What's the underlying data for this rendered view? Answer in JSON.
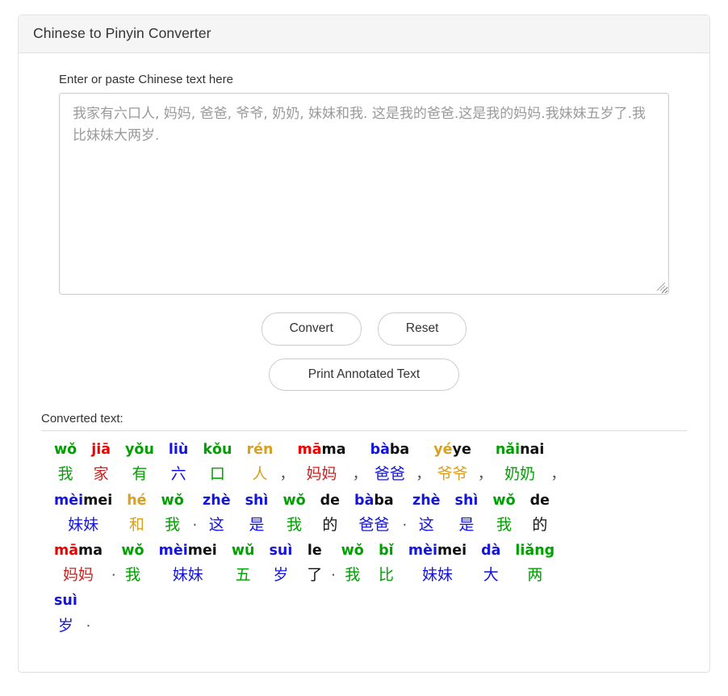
{
  "card": {
    "title": "Chinese to Pinyin Converter"
  },
  "input": {
    "label": "Enter or paste Chinese text here",
    "value": "我家有六口人, 妈妈, 爸爸, 爷爷, 奶奶, 妹妹和我. 这是我的爸爸.这是我的妈妈.我妹妹五岁了.我比妹妹大两岁.",
    "placeholder": ""
  },
  "buttons": {
    "convert": "Convert",
    "reset": "Reset",
    "print": "Print Annotated Text"
  },
  "output": {
    "label": "Converted text:",
    "tone_colors": {
      "tone1": "#ee0000",
      "tone2": "#d9a022",
      "tone3": "#00a000",
      "tone4": "#1414e0",
      "neutral": "#111111"
    },
    "lines": [
      [
        {
          "pinyin": "wǒ",
          "hanzi": "我",
          "tone": "t3",
          "hanzi_tone": "t3d"
        },
        {
          "pinyin": "jiā",
          "hanzi": "家",
          "tone": "t1",
          "hanzi_tone": "t1d"
        },
        {
          "pinyin": "yǒu",
          "hanzi": "有",
          "tone": "t3",
          "hanzi_tone": "t3d"
        },
        {
          "pinyin": "liù",
          "hanzi": "六",
          "tone": "t4",
          "hanzi_tone": "t4d"
        },
        {
          "pinyin": "kǒu",
          "hanzi": "口",
          "tone": "t3",
          "hanzi_tone": "t3d"
        },
        {
          "pinyin": "rén",
          "hanzi": "人",
          "tone": "t2",
          "hanzi_tone": "t2d"
        },
        {
          "pinyin": "",
          "hanzi": "，",
          "tone": "t5",
          "hanzi_tone": "punctmark",
          "punct": true
        },
        {
          "pinyin": "māma",
          "hanzi": "妈妈",
          "tone": "t1",
          "hanzi_tone": "t1d",
          "tone2part": "t5",
          "split": 2
        },
        {
          "pinyin": "",
          "hanzi": "，",
          "tone": "t5",
          "hanzi_tone": "punctmark",
          "punct": true
        },
        {
          "pinyin": "bàba",
          "hanzi": "爸爸",
          "tone": "t4",
          "hanzi_tone": "t4d",
          "tone2part": "t5",
          "split": 2
        },
        {
          "pinyin": "",
          "hanzi": "，",
          "tone": "t5",
          "hanzi_tone": "punctmark",
          "punct": true
        },
        {
          "pinyin": "yéye",
          "hanzi": "爷爷",
          "tone": "t2",
          "hanzi_tone": "t2d",
          "tone2part": "t5",
          "split": 2
        },
        {
          "pinyin": "",
          "hanzi": "，",
          "tone": "t5",
          "hanzi_tone": "punctmark",
          "punct": true
        },
        {
          "pinyin": "nǎinai",
          "hanzi": "奶奶",
          "tone": "t3",
          "hanzi_tone": "t3d",
          "tone2part": "t5",
          "split": 3
        },
        {
          "pinyin": "",
          "hanzi": "，",
          "tone": "t5",
          "hanzi_tone": "punctmark",
          "punct": true
        }
      ],
      [
        {
          "pinyin": "mèimei",
          "hanzi": "妹妹",
          "tone": "t4",
          "hanzi_tone": "t4d",
          "tone2part": "t5",
          "split": 3
        },
        {
          "pinyin": "hé",
          "hanzi": "和",
          "tone": "t2",
          "hanzi_tone": "t2d"
        },
        {
          "pinyin": "wǒ",
          "hanzi": "我",
          "tone": "t3",
          "hanzi_tone": "t3d"
        },
        {
          "pinyin": "",
          "hanzi": "·",
          "tone": "t5",
          "hanzi_tone": "punctmark",
          "punct": true
        },
        {
          "pinyin": "zhè",
          "hanzi": "这",
          "tone": "t4",
          "hanzi_tone": "t4d"
        },
        {
          "pinyin": "shì",
          "hanzi": "是",
          "tone": "t4",
          "hanzi_tone": "t4d"
        },
        {
          "pinyin": "wǒ",
          "hanzi": "我",
          "tone": "t3",
          "hanzi_tone": "t3d"
        },
        {
          "pinyin": "de",
          "hanzi": "的",
          "tone": "t5",
          "hanzi_tone": "t5"
        },
        {
          "pinyin": "bàba",
          "hanzi": "爸爸",
          "tone": "t4",
          "hanzi_tone": "t4d",
          "tone2part": "t5",
          "split": 2
        },
        {
          "pinyin": "",
          "hanzi": "·",
          "tone": "t5",
          "hanzi_tone": "punctmark",
          "punct": true
        },
        {
          "pinyin": "zhè",
          "hanzi": "这",
          "tone": "t4",
          "hanzi_tone": "t4d"
        },
        {
          "pinyin": "shì",
          "hanzi": "是",
          "tone": "t4",
          "hanzi_tone": "t4d"
        },
        {
          "pinyin": "wǒ",
          "hanzi": "我",
          "tone": "t3",
          "hanzi_tone": "t3d"
        },
        {
          "pinyin": "de",
          "hanzi": "的",
          "tone": "t5",
          "hanzi_tone": "t5"
        }
      ],
      [
        {
          "pinyin": "māma",
          "hanzi": "妈妈",
          "tone": "t1",
          "hanzi_tone": "t1d",
          "tone2part": "t5",
          "split": 2
        },
        {
          "pinyin": "",
          "hanzi": "·",
          "tone": "t5",
          "hanzi_tone": "punctmark",
          "punct": true
        },
        {
          "pinyin": "wǒ",
          "hanzi": "我",
          "tone": "t3",
          "hanzi_tone": "t3d"
        },
        {
          "pinyin": "mèimei",
          "hanzi": "妹妹",
          "tone": "t4",
          "hanzi_tone": "t4d",
          "tone2part": "t5",
          "split": 3
        },
        {
          "pinyin": "wǔ",
          "hanzi": "五",
          "tone": "t3",
          "hanzi_tone": "t3d"
        },
        {
          "pinyin": "suì",
          "hanzi": "岁",
          "tone": "t4",
          "hanzi_tone": "t4d"
        },
        {
          "pinyin": "le",
          "hanzi": "了",
          "tone": "t5",
          "hanzi_tone": "t5"
        },
        {
          "pinyin": "",
          "hanzi": "·",
          "tone": "t5",
          "hanzi_tone": "punctmark",
          "punct": true
        },
        {
          "pinyin": "wǒ",
          "hanzi": "我",
          "tone": "t3",
          "hanzi_tone": "t3d"
        },
        {
          "pinyin": "bǐ",
          "hanzi": "比",
          "tone": "t3",
          "hanzi_tone": "t3d"
        },
        {
          "pinyin": "mèimei",
          "hanzi": "妹妹",
          "tone": "t4",
          "hanzi_tone": "t4d",
          "tone2part": "t5",
          "split": 3
        },
        {
          "pinyin": "dà",
          "hanzi": "大",
          "tone": "t4",
          "hanzi_tone": "t4d"
        },
        {
          "pinyin": "liǎng",
          "hanzi": "两",
          "tone": "t3",
          "hanzi_tone": "t3d"
        }
      ],
      [
        {
          "pinyin": "suì",
          "hanzi": "岁",
          "tone": "t4",
          "hanzi_tone": "t4d"
        },
        {
          "pinyin": "",
          "hanzi": "·",
          "tone": "t5",
          "hanzi_tone": "punctmark",
          "punct": true
        }
      ]
    ]
  }
}
